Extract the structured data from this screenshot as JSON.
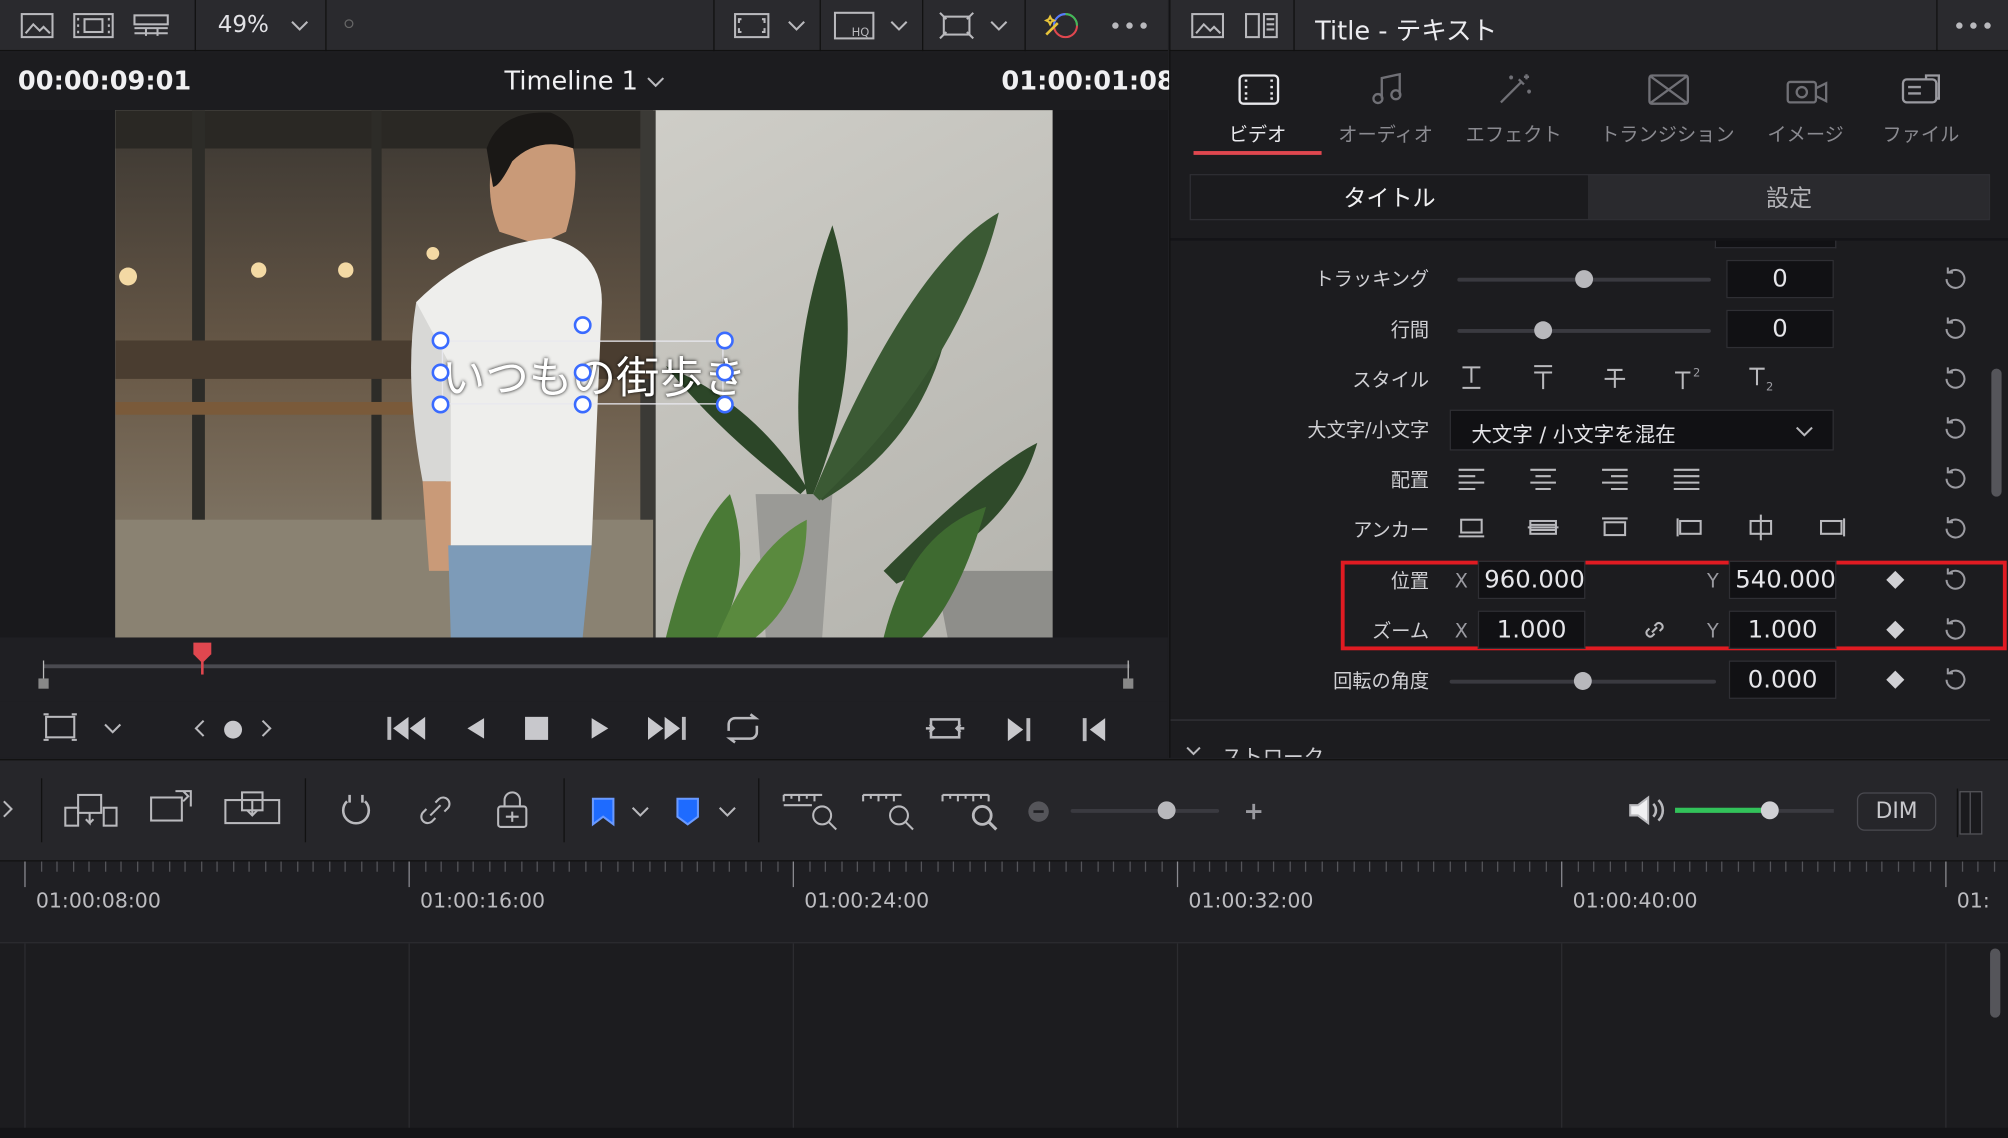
{
  "viewer": {
    "zoom_label": "49%",
    "timecode_left": "00:00:09:01",
    "timeline_name": "Timeline 1",
    "timecode_right": "01:00:01:08",
    "title_text": "いつもの街歩き"
  },
  "inspector": {
    "window_title": "Title - テキスト",
    "tabs": [
      {
        "label": "ビデオ",
        "icon": "film-icon",
        "active": true
      },
      {
        "label": "オーディオ",
        "icon": "music-note-icon",
        "active": false
      },
      {
        "label": "エフェクト",
        "icon": "magic-wand-icon",
        "active": false
      },
      {
        "label": "トランジション",
        "icon": "transition-icon",
        "active": false
      },
      {
        "label": "イメージ",
        "icon": "camera-icon",
        "active": false
      },
      {
        "label": "ファイル",
        "icon": "file-icon",
        "active": false
      }
    ],
    "segments": {
      "title": "タイトル",
      "settings": "設定"
    },
    "tracking": {
      "label": "トラッキング",
      "value": "0",
      "slider": 0.5
    },
    "line_spacing": {
      "label": "行間",
      "value": "0",
      "slider": 0.34
    },
    "style": {
      "label": "スタイル"
    },
    "case": {
      "label": "大文字/小文字",
      "value": "大文字 / 小文字を混在"
    },
    "alignment": {
      "label": "配置"
    },
    "anchor": {
      "label": "アンカー"
    },
    "position": {
      "label": "位置",
      "x_label": "X",
      "x": "960.000",
      "y_label": "Y",
      "y": "540.000"
    },
    "zoom": {
      "label": "ズーム",
      "x_label": "X",
      "x": "1.000",
      "y_label": "Y",
      "y": "1.000"
    },
    "rotation": {
      "label": "回転の角度",
      "value": "0.000",
      "slider": 0.5
    },
    "stroke_section": "ストローク"
  },
  "toolbar": {
    "dim_label": "DIM",
    "volume_level": 0.6
  },
  "timeline": {
    "ruler": [
      "01:00:08:00",
      "01:00:16:00",
      "01:00:24:00",
      "01:00:32:00",
      "01:00:40:00",
      "01:"
    ]
  },
  "colors": {
    "accent_red": "#e01b22",
    "selection_blue": "#3a6bff",
    "tab_active": "#e0474f",
    "volume_green": "#32c25a",
    "flag_blue": "#1e6bff"
  }
}
